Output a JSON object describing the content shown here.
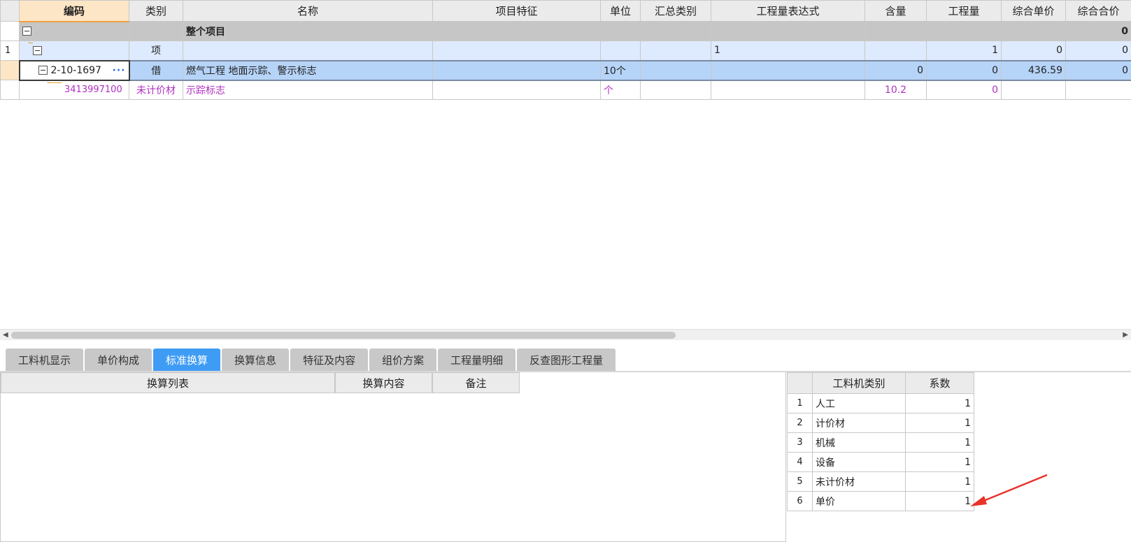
{
  "main_table": {
    "columns": [
      "编码",
      "类别",
      "名称",
      "项目特征",
      "单位",
      "汇总类别",
      "工程量表达式",
      "含量",
      "工程量",
      "综合单价",
      "综合合价"
    ],
    "total_row": {
      "name": "整个项目",
      "total_price": "0"
    },
    "item_row": {
      "row_no": "1",
      "category": "项",
      "expression": "1",
      "quantity": "1",
      "unit_price": "0",
      "total_price": "0"
    },
    "selected_row": {
      "code": "2-10-1697",
      "category": "借",
      "name": "燃气工程 地面示踪、警示标志",
      "unit": "10个",
      "content": "0",
      "quantity": "0",
      "unit_price": "436.59",
      "total_price": "0"
    },
    "sub_row": {
      "code": "3413997100",
      "category": "未计价材",
      "name": "示踪标志",
      "unit": "个",
      "content": "10.2",
      "quantity": "0"
    }
  },
  "tabs": [
    {
      "label": "工料机显示"
    },
    {
      "label": "单价构成"
    },
    {
      "label": "标准换算",
      "active": true
    },
    {
      "label": "换算信息"
    },
    {
      "label": "特征及内容"
    },
    {
      "label": "组价方案"
    },
    {
      "label": "工程量明细"
    },
    {
      "label": "反查图形工程量"
    }
  ],
  "conversion_panel": {
    "columns": [
      "换算列表",
      "换算内容",
      "备注"
    ]
  },
  "coefficient_table": {
    "columns": [
      "工料机类别",
      "系数"
    ],
    "rows": [
      {
        "no": "1",
        "category": "人工",
        "coef": "1"
      },
      {
        "no": "2",
        "category": "计价材",
        "coef": "1"
      },
      {
        "no": "3",
        "category": "机械",
        "coef": "1"
      },
      {
        "no": "4",
        "category": "设备",
        "coef": "1"
      },
      {
        "no": "5",
        "category": "未计价材",
        "coef": "1"
      },
      {
        "no": "6",
        "category": "单价",
        "coef": "1"
      }
    ]
  },
  "colors": {
    "accent_tab": "#3f9cf5",
    "selected_row": "#b6d4f8",
    "sub_row_text": "#b030c0",
    "annotation_arrow": "#e8322a"
  }
}
